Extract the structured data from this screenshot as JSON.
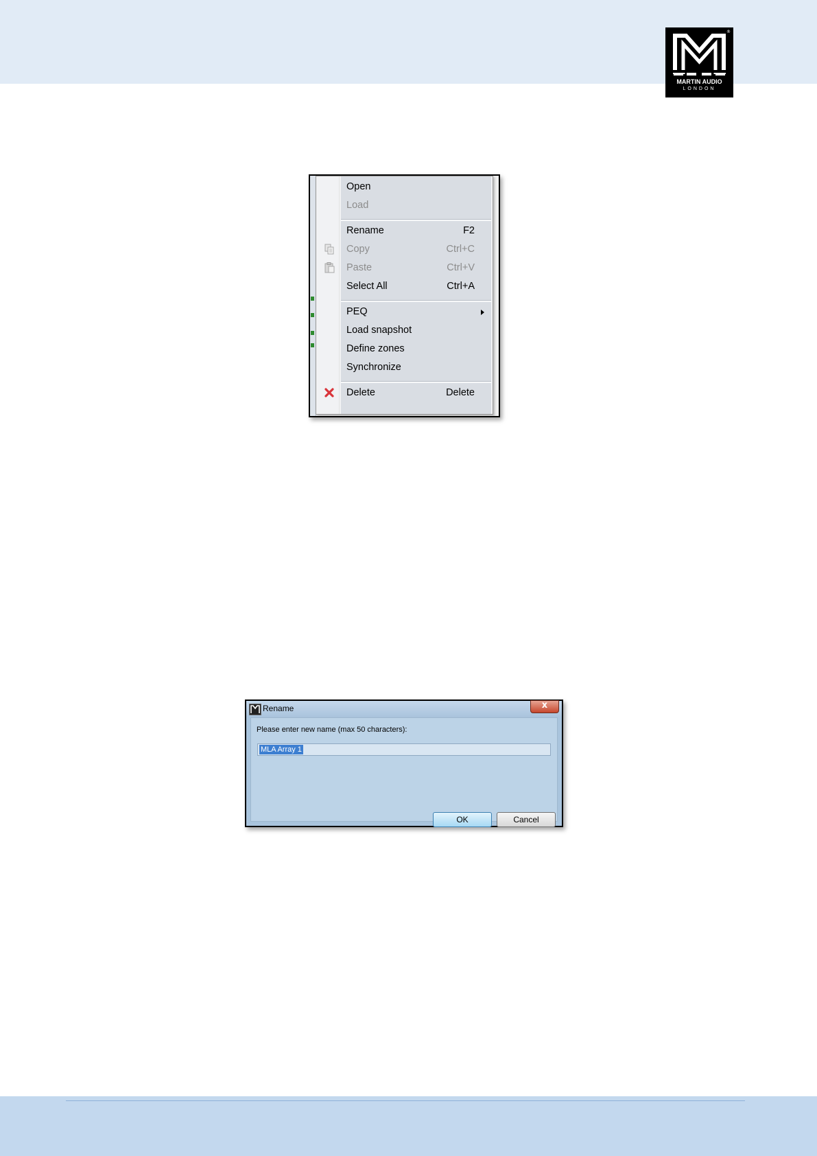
{
  "brand": {
    "line1": "MARTIN AUDIO",
    "line2": "LONDON",
    "reg": "®",
    "colors": {
      "header_band": "#e1ebf6",
      "footer_band": "#c3d8ee",
      "logo_bg": "#000000"
    }
  },
  "context_menu": {
    "items": [
      {
        "label": "Open",
        "shortcut": "",
        "enabled": true,
        "icon": ""
      },
      {
        "label": "Load",
        "shortcut": "",
        "enabled": false,
        "icon": ""
      },
      {
        "label": "Rename",
        "shortcut": "F2",
        "enabled": true,
        "icon": ""
      },
      {
        "label": "Copy",
        "shortcut": "Ctrl+C",
        "enabled": false,
        "icon": "copy-icon"
      },
      {
        "label": "Paste",
        "shortcut": "Ctrl+V",
        "enabled": false,
        "icon": "paste-icon"
      },
      {
        "label": "Select All",
        "shortcut": "Ctrl+A",
        "enabled": true,
        "icon": ""
      },
      {
        "label": "PEQ",
        "shortcut": "",
        "enabled": true,
        "icon": "",
        "submenu": true
      },
      {
        "label": "Load snapshot",
        "shortcut": "",
        "enabled": true,
        "icon": ""
      },
      {
        "label": "Define zones",
        "shortcut": "",
        "enabled": true,
        "icon": ""
      },
      {
        "label": "Synchronize",
        "shortcut": "",
        "enabled": true,
        "icon": ""
      },
      {
        "label": "Delete",
        "shortcut": "Delete",
        "enabled": true,
        "icon": "delete-x-icon",
        "icon_color": "#d9343a"
      }
    ]
  },
  "rename_dialog": {
    "title": "Rename",
    "close_glyph": "x",
    "prompt": "Please enter new name (max 50 characters):",
    "value": "MLA Array 1",
    "ok_label": "OK",
    "cancel_label": "Cancel"
  }
}
